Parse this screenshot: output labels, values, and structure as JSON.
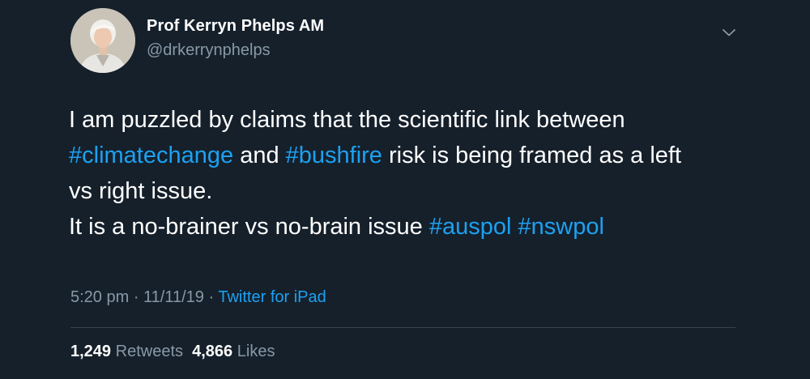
{
  "author": {
    "name": "Prof Kerryn Phelps AM",
    "handle": "@drkerrynphelps"
  },
  "tweet": {
    "line1": "I am puzzled by claims that the scientific link between",
    "line2_tag1": "#climatechange",
    "line2_mid": " and ",
    "line2_tag2": "#bushfire",
    "line2_tail": " risk is being framed as a left",
    "line3": "vs right issue.",
    "line4_text": "It is a no-brainer vs no-brain issue ",
    "line4_tag1": "#auspol",
    "line4_tag2": "#nswpol"
  },
  "meta": {
    "time": "5:20 pm",
    "separator": " · ",
    "date": "11/11/19",
    "source": "Twitter for iPad"
  },
  "stats": {
    "retweets_count": "1,249",
    "retweets_label": "Retweets",
    "likes_count": "4,866",
    "likes_label": "Likes"
  },
  "colors": {
    "background": "#15202b",
    "accent": "#1da1f2",
    "secondary_text": "#8899a6",
    "divider": "#38444d"
  },
  "icons": {
    "caret": "chevron-down-icon"
  }
}
